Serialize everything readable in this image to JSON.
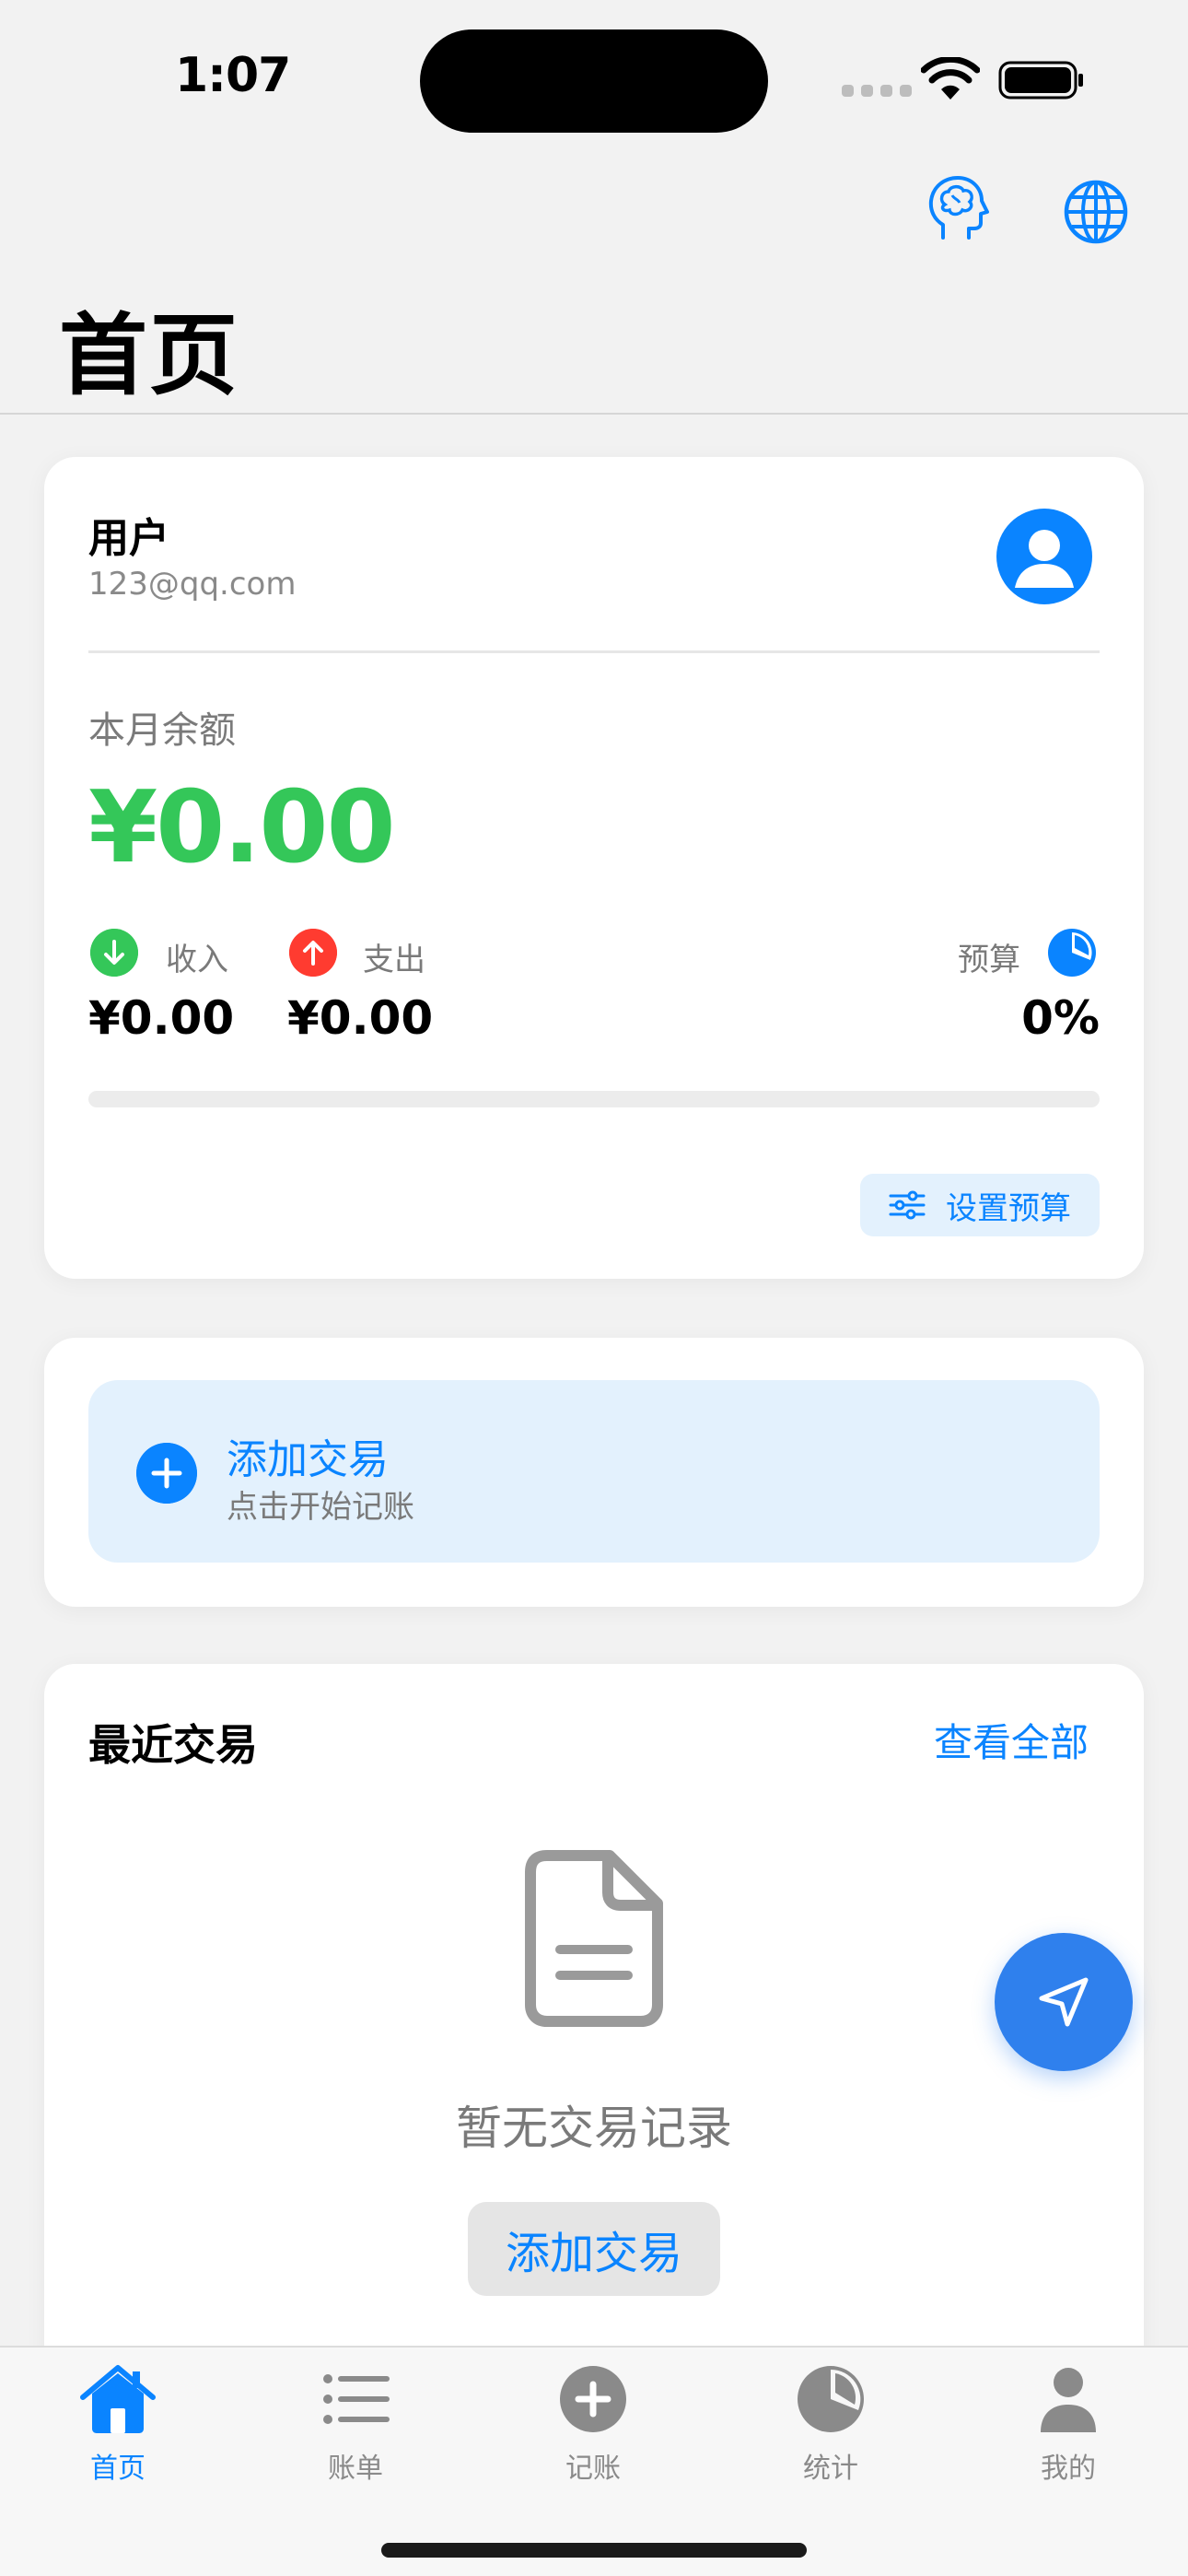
{
  "status_bar": {
    "time": "1:07"
  },
  "header": {
    "title": "首页"
  },
  "user_card": {
    "name": "用户",
    "email": "123@qq.com",
    "balance_label": "本月余额",
    "balance": "¥0.00",
    "income_label": "收入",
    "income": "¥0.00",
    "expense_label": "支出",
    "expense": "¥0.00",
    "budget_label": "预算",
    "budget_percent": "0%",
    "budget_progress": 0,
    "set_budget_label": "设置预算"
  },
  "add_card": {
    "title": "添加交易",
    "subtitle": "点击开始记账"
  },
  "recent": {
    "title": "最近交易",
    "see_all": "查看全部",
    "empty_text": "暂无交易记录",
    "empty_button": "添加交易"
  },
  "tabbar": {
    "items": [
      {
        "label": "首页",
        "icon": "home-icon",
        "active": true
      },
      {
        "label": "账单",
        "icon": "list-icon",
        "active": false
      },
      {
        "label": "记账",
        "icon": "plus-circle-icon",
        "active": false
      },
      {
        "label": "统计",
        "icon": "pie-chart-icon",
        "active": false
      },
      {
        "label": "我的",
        "icon": "person-icon",
        "active": false
      }
    ]
  },
  "colors": {
    "accent": "#0a84ff",
    "income": "#34c759",
    "expense": "#ff3b30",
    "inactive": "#8a8a8a"
  }
}
